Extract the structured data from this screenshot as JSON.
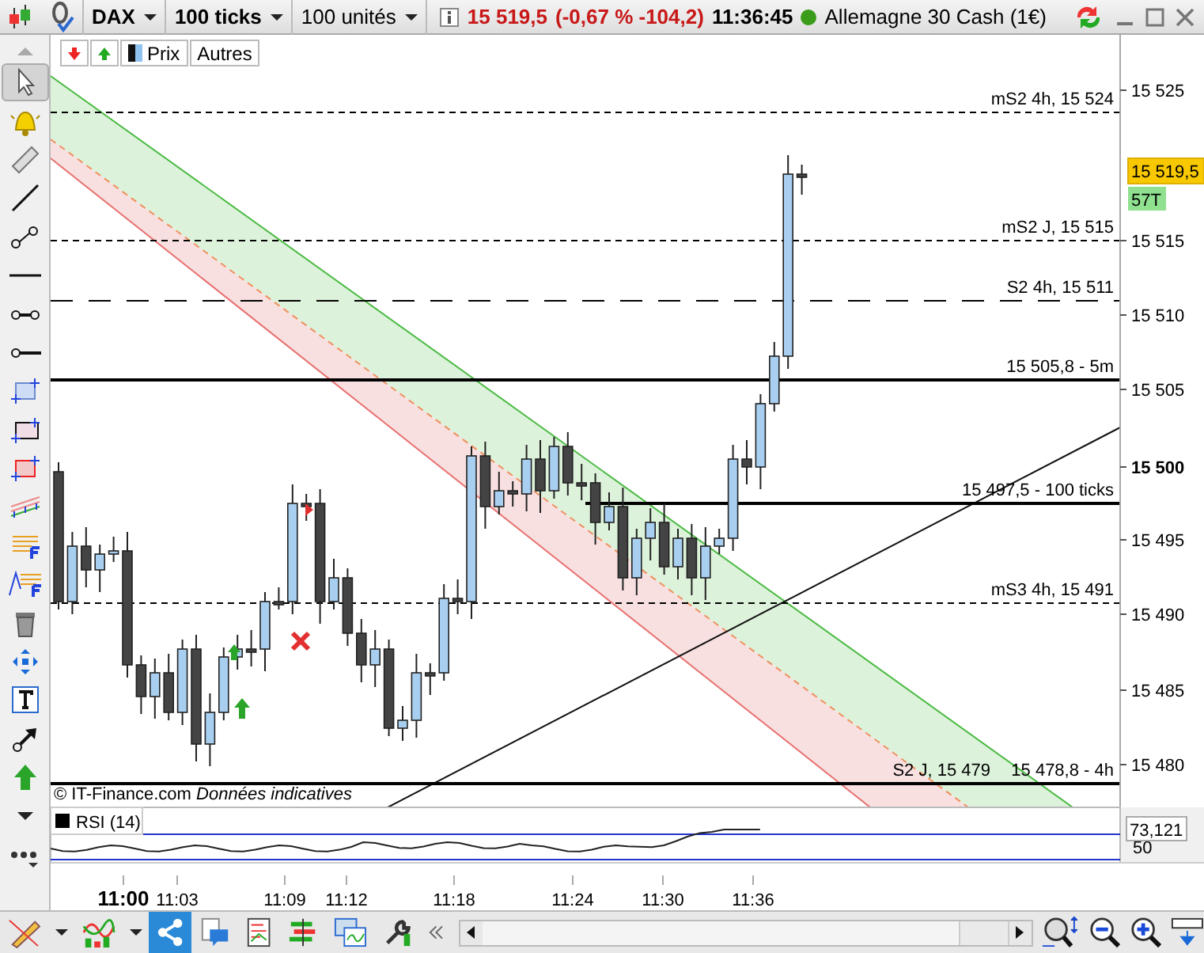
{
  "toolbar": {
    "symbol": "DAX",
    "period": "100 ticks",
    "quantity": "100 unités",
    "price": "15 519,5",
    "change": "(-0,67 % -104,2)",
    "time": "11:36:45",
    "instrument": "Allemagne 30 Cash (1€)"
  },
  "chart_buttons": [
    "Prix",
    "Autres"
  ],
  "levels": [
    {
      "label": "mS2 4h, 15 524",
      "kind": "dotted"
    },
    {
      "label": "mS2 J, 15 515",
      "kind": "dotted"
    },
    {
      "label": "S2 4h, 15 511",
      "kind": "dashed"
    },
    {
      "label": "15 505,8 - 5m",
      "kind": "solid"
    },
    {
      "label": "15 497,5 - 100 ticks",
      "kind": "solid"
    },
    {
      "label": "mS3 4h, 15 491",
      "kind": "dotted"
    },
    {
      "label": "15 478,8 - 4h",
      "extra_label": "S2 J, 15 479",
      "kind": "solid"
    }
  ],
  "price_axis": {
    "ticks": [
      {
        "label": "15 525",
        "bold": false
      },
      {
        "label": "15 515",
        "bold": false
      },
      {
        "label": "15 510",
        "bold": false
      },
      {
        "label": "15 505",
        "bold": false
      },
      {
        "label": "15 500",
        "bold": true
      },
      {
        "label": "15 495",
        "bold": false
      },
      {
        "label": "15 490",
        "bold": false
      },
      {
        "label": "15 485",
        "bold": false
      },
      {
        "label": "15 480",
        "bold": false
      }
    ],
    "last_price": "15 519,5",
    "volume": "57T"
  },
  "footer": "© IT-Finance.com *Données indicatives*",
  "rsi": {
    "label": "RSI (14)",
    "value": "73,121",
    "tick": "50"
  },
  "time_axis": [
    {
      "label": "11:00",
      "bold": true
    },
    {
      "label": "11:03",
      "bold": false
    },
    {
      "label": "11:09",
      "bold": false
    },
    {
      "label": "11:12",
      "bold": false
    },
    {
      "label": "11:18",
      "bold": false
    },
    {
      "label": "11:24",
      "bold": false
    },
    {
      "label": "11:30",
      "bold": false
    },
    {
      "label": "11:36",
      "bold": false
    }
  ]
}
